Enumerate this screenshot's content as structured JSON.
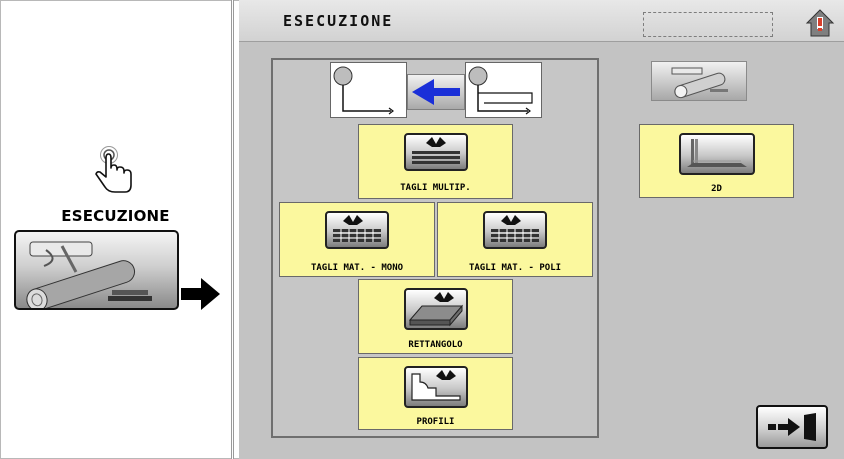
{
  "left_panel": {
    "label": "ESECUZIONE",
    "icons": {
      "hand": "pointing-hand-icon",
      "arrow": "right-arrow-icon",
      "button": "esecuzione-icon"
    }
  },
  "screen": {
    "title": "ESECUZIONE",
    "buttons": {
      "multip": "TAGLI MULTIP.",
      "mono": "TAGLI MAT. - MONO",
      "poli": "TAGLI MAT. - POLI",
      "rettangolo": "RETTANGOLO",
      "profili": "PROFILI",
      "two_d": "2D"
    }
  },
  "colors": {
    "screen_bg": "#c3c3c3",
    "button_yellow": "#fbf89e",
    "swap_arrow": "#1a2fd8",
    "home_red": "#d9402b"
  }
}
